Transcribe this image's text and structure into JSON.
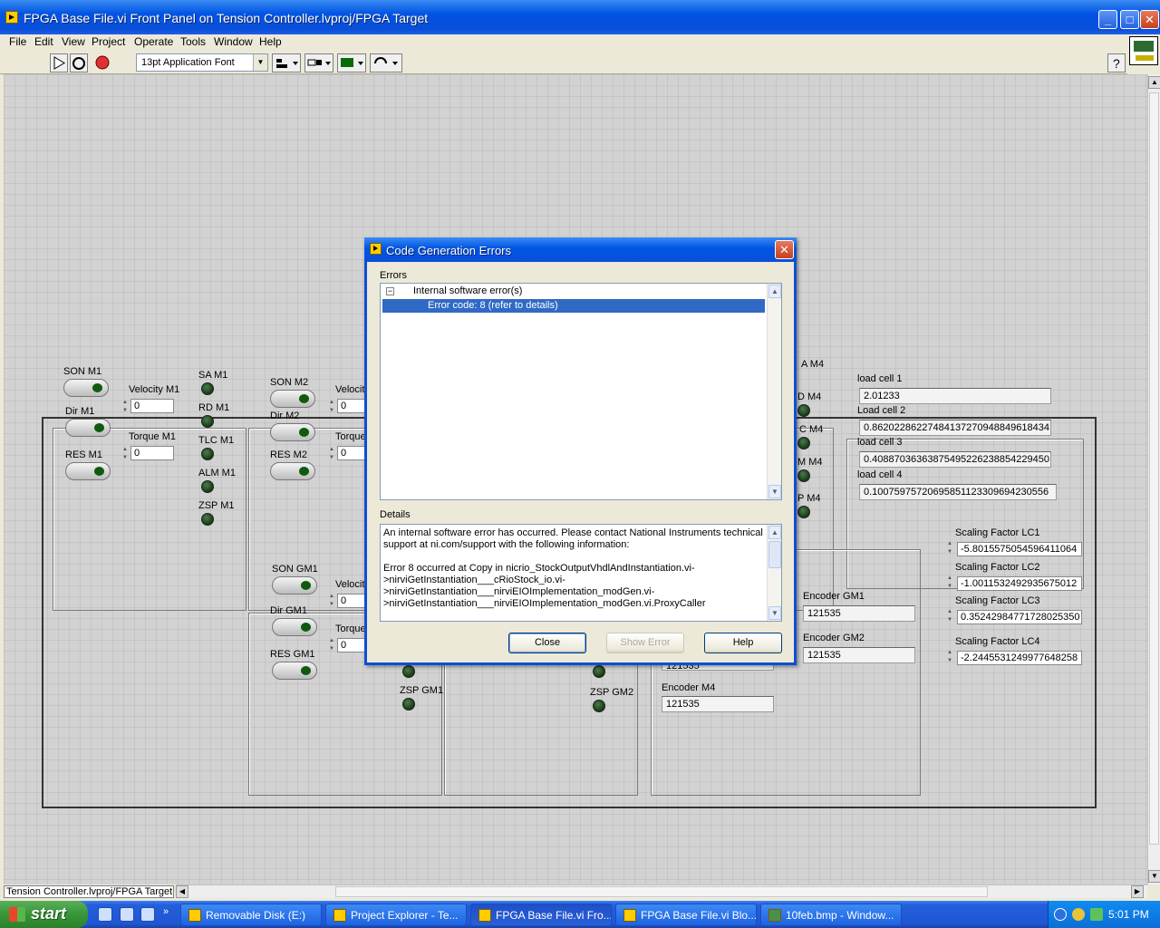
{
  "window": {
    "title": "FPGA Base File.vi Front Panel on Tension Controller.lvproj/FPGA Target"
  },
  "menu": [
    "File",
    "Edit",
    "View",
    "Project",
    "Operate",
    "Tools",
    "Window",
    "Help"
  ],
  "toolbar": {
    "font_value": "13pt Application Font"
  },
  "panel": {
    "m1": {
      "son": "SON M1",
      "dir": "Dir M1",
      "res": "RES M1",
      "velocity_label": "Velocity M1",
      "velocity_value": "0",
      "torque_label": "Torque M1",
      "torque_value": "0",
      "sa": "SA M1",
      "rd": "RD M1",
      "tlc": "TLC M1",
      "alm": "ALM M1",
      "zsp": "ZSP M1"
    },
    "m2": {
      "son": "SON M2",
      "dir": "Dir M2",
      "res": "RES M2",
      "velocity_label": "Velocity",
      "velocity_value": "0",
      "torque_label": "Torque",
      "torque_value": "0"
    },
    "gm1": {
      "son": "SON GM1",
      "dir": "Dir GM1",
      "res": "RES GM1",
      "velocity_label": "Velocity",
      "velocity_value": "0",
      "torque_label": "Torque",
      "torque_value": "0",
      "zsp": "ZSP GM1"
    },
    "gm2": {
      "zsp": "ZSP GM2"
    },
    "m4_leds": [
      "A M4",
      "D M4",
      "C M4",
      "M M4",
      "P M4"
    ],
    "load_cells": [
      {
        "label": "load cell 1",
        "value": "2.01233"
      },
      {
        "label": "Load cell 2",
        "value": "0.86202286227484137270948849618434"
      },
      {
        "label": "load cell 3",
        "value": "0.40887036363875495226238854229450"
      },
      {
        "label": "load cell 4",
        "value": "0.10075975720695851123309694230556"
      }
    ],
    "scaling": [
      {
        "label": "Scaling Factor LC1",
        "value": "-5.8015575054596411064"
      },
      {
        "label": "Scaling Factor LC2",
        "value": "-1.0011532492935675012"
      },
      {
        "label": "Scaling Factor LC3",
        "value": "0.35242984771728025350"
      },
      {
        "label": "Scaling Factor LC4",
        "value": "-2.2445531249977648258"
      }
    ],
    "encoders": [
      {
        "label": "Encoder GM1",
        "value": "121535"
      },
      {
        "label": "Encoder GM2",
        "value": "121535"
      },
      {
        "label": "Encoder M4",
        "value": "121535"
      }
    ],
    "partial_encoder_value": "121535"
  },
  "dialog": {
    "title": "Code Generation Errors",
    "errors_label": "Errors",
    "tree_root": "Internal software error(s)",
    "tree_child": "Error code: 8 (refer to details)",
    "details_label": "Details",
    "details_text": "An internal software error has occurred. Please contact National Instruments technical support at ni.com/support with the following information:\n\nError 8 occurred at Copy in nicrio_StockOutputVhdlAndInstantiation.vi->nirviGetInstantiation___cRioStock_io.vi->nirviGetInstantiation___nirviEIOImplementation_modGen.vi->nirviGetInstantiation___nirviEIOImplementation_modGen.vi.ProxyCaller",
    "close_label": "Close",
    "show_error_label": "Show Error",
    "help_label": "Help"
  },
  "status_path": "Tension Controller.lvproj/FPGA Target",
  "taskbar": {
    "start": "start",
    "tasks": [
      "Removable Disk (E:)",
      "Project Explorer - Te...",
      "FPGA Base File.vi Fro...",
      "FPGA Base File.vi Blo...",
      "10feb.bmp - Window..."
    ],
    "clock": "5:01 PM"
  }
}
